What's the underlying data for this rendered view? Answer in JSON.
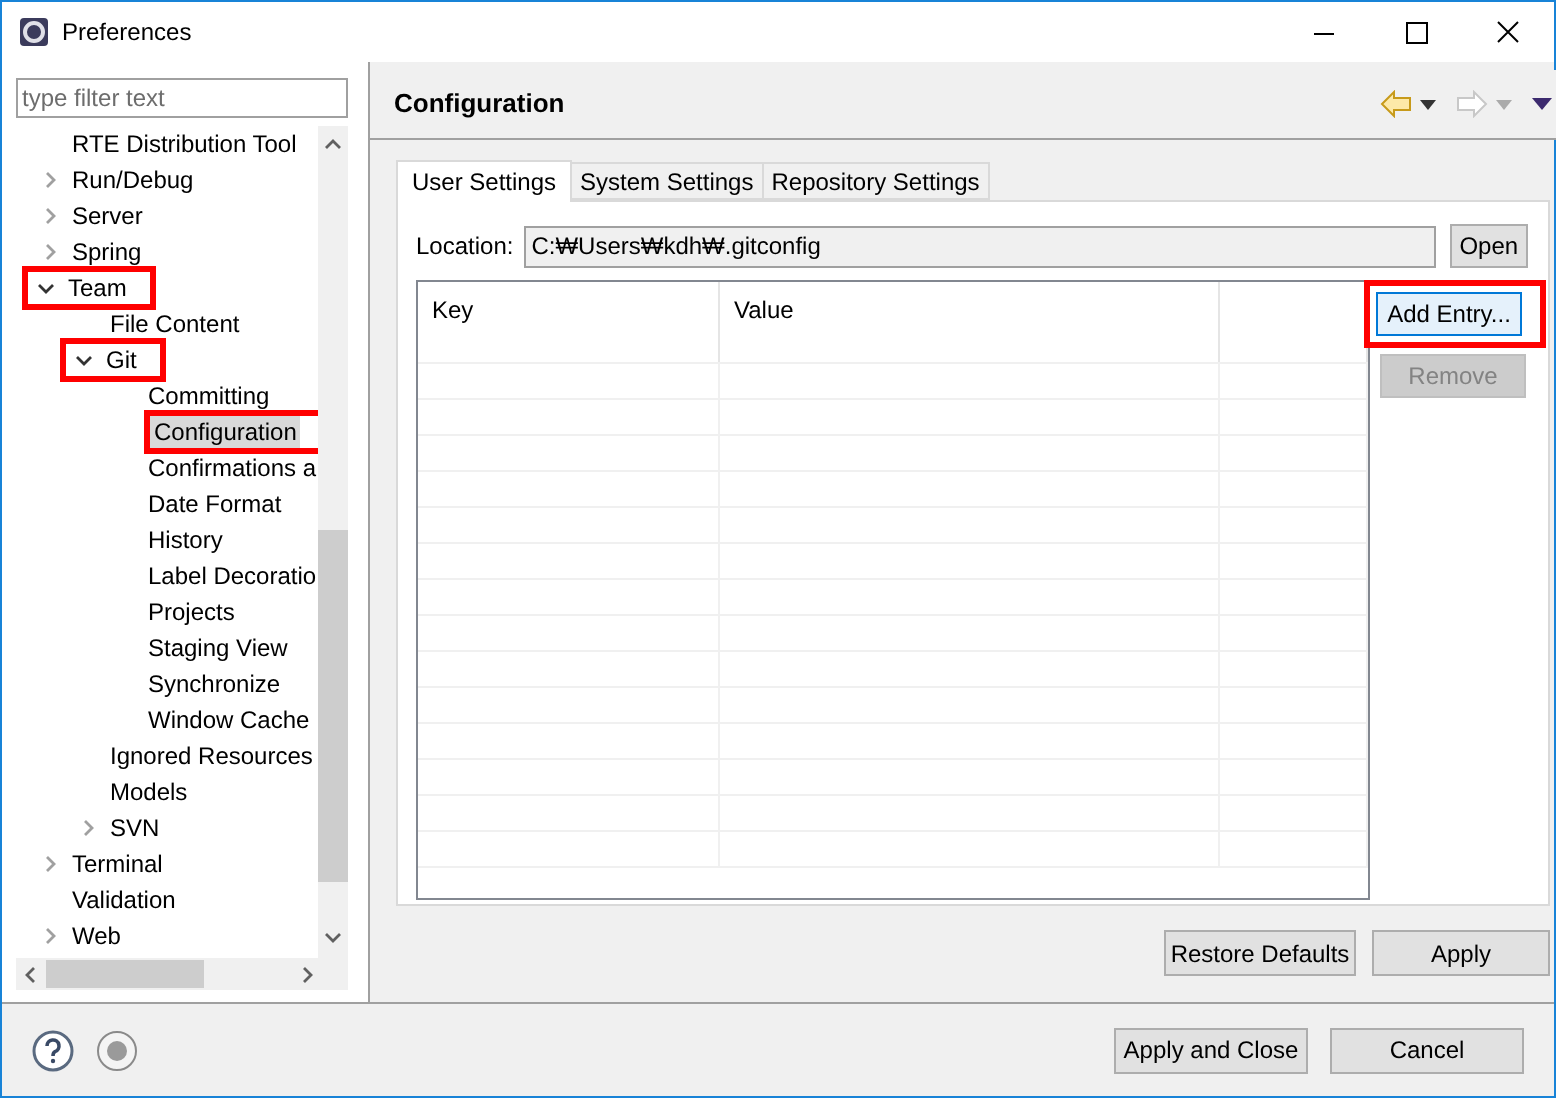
{
  "window": {
    "title": "Preferences"
  },
  "filter": {
    "placeholder": "type filter text"
  },
  "tree": [
    {
      "label": "RTE Distribution Tool",
      "expandable": false,
      "expanded": false,
      "selected": false,
      "highlighted": false
    },
    {
      "label": "Run/Debug",
      "expandable": true,
      "expanded": false,
      "selected": false,
      "highlighted": false
    },
    {
      "label": "Server",
      "expandable": true,
      "expanded": false,
      "selected": false,
      "highlighted": false
    },
    {
      "label": "Spring",
      "expandable": true,
      "expanded": false,
      "selected": false,
      "highlighted": false
    },
    {
      "label": "Team",
      "expandable": true,
      "expanded": true,
      "selected": false,
      "highlighted": true,
      "children": [
        {
          "label": "File Content",
          "expandable": false,
          "expanded": false,
          "selected": false,
          "highlighted": false
        },
        {
          "label": "Git",
          "expandable": true,
          "expanded": true,
          "selected": false,
          "highlighted": true,
          "children": [
            {
              "label": "Committing",
              "expandable": false,
              "expanded": false,
              "selected": false,
              "highlighted": false
            },
            {
              "label": "Configuration",
              "expandable": false,
              "expanded": false,
              "selected": true,
              "highlighted": true
            },
            {
              "label": "Confirmations a",
              "expandable": false,
              "expanded": false,
              "selected": false,
              "highlighted": false
            },
            {
              "label": "Date Format",
              "expandable": false,
              "expanded": false,
              "selected": false,
              "highlighted": false
            },
            {
              "label": "History",
              "expandable": false,
              "expanded": false,
              "selected": false,
              "highlighted": false
            },
            {
              "label": "Label Decoratio",
              "expandable": false,
              "expanded": false,
              "selected": false,
              "highlighted": false
            },
            {
              "label": "Projects",
              "expandable": false,
              "expanded": false,
              "selected": false,
              "highlighted": false
            },
            {
              "label": "Staging View",
              "expandable": false,
              "expanded": false,
              "selected": false,
              "highlighted": false
            },
            {
              "label": "Synchronize",
              "expandable": false,
              "expanded": false,
              "selected": false,
              "highlighted": false
            },
            {
              "label": "Window Cache",
              "expandable": false,
              "expanded": false,
              "selected": false,
              "highlighted": false
            }
          ]
        },
        {
          "label": "Ignored Resources",
          "expandable": false,
          "expanded": false,
          "selected": false,
          "highlighted": false
        },
        {
          "label": "Models",
          "expandable": false,
          "expanded": false,
          "selected": false,
          "highlighted": false
        },
        {
          "label": "SVN",
          "expandable": true,
          "expanded": false,
          "selected": false,
          "highlighted": false
        }
      ]
    },
    {
      "label": "Terminal",
      "expandable": true,
      "expanded": false,
      "selected": false,
      "highlighted": false
    },
    {
      "label": "Validation",
      "expandable": false,
      "expanded": false,
      "selected": false,
      "highlighted": false
    },
    {
      "label": "Web",
      "expandable": true,
      "expanded": false,
      "selected": false,
      "highlighted": false
    }
  ],
  "page": {
    "title": "Configuration",
    "tabs": [
      {
        "label": "User Settings",
        "selected": true
      },
      {
        "label": "System Settings",
        "selected": false
      },
      {
        "label": "Repository Settings",
        "selected": false
      }
    ],
    "location": {
      "label": "Location:",
      "value": "C:₩Users₩kdh₩.gitconfig"
    },
    "open_button": "Open",
    "table": {
      "columns": [
        "Key",
        "Value"
      ]
    },
    "side_buttons": [
      {
        "label": "Add Entry...",
        "disabled": false,
        "highlighted": true
      },
      {
        "label": "Remove",
        "disabled": true,
        "highlighted": false
      }
    ],
    "buttons": [
      "Restore Defaults",
      "Apply"
    ]
  },
  "dialog_buttons": [
    "Apply and Close",
    "Cancel"
  ]
}
